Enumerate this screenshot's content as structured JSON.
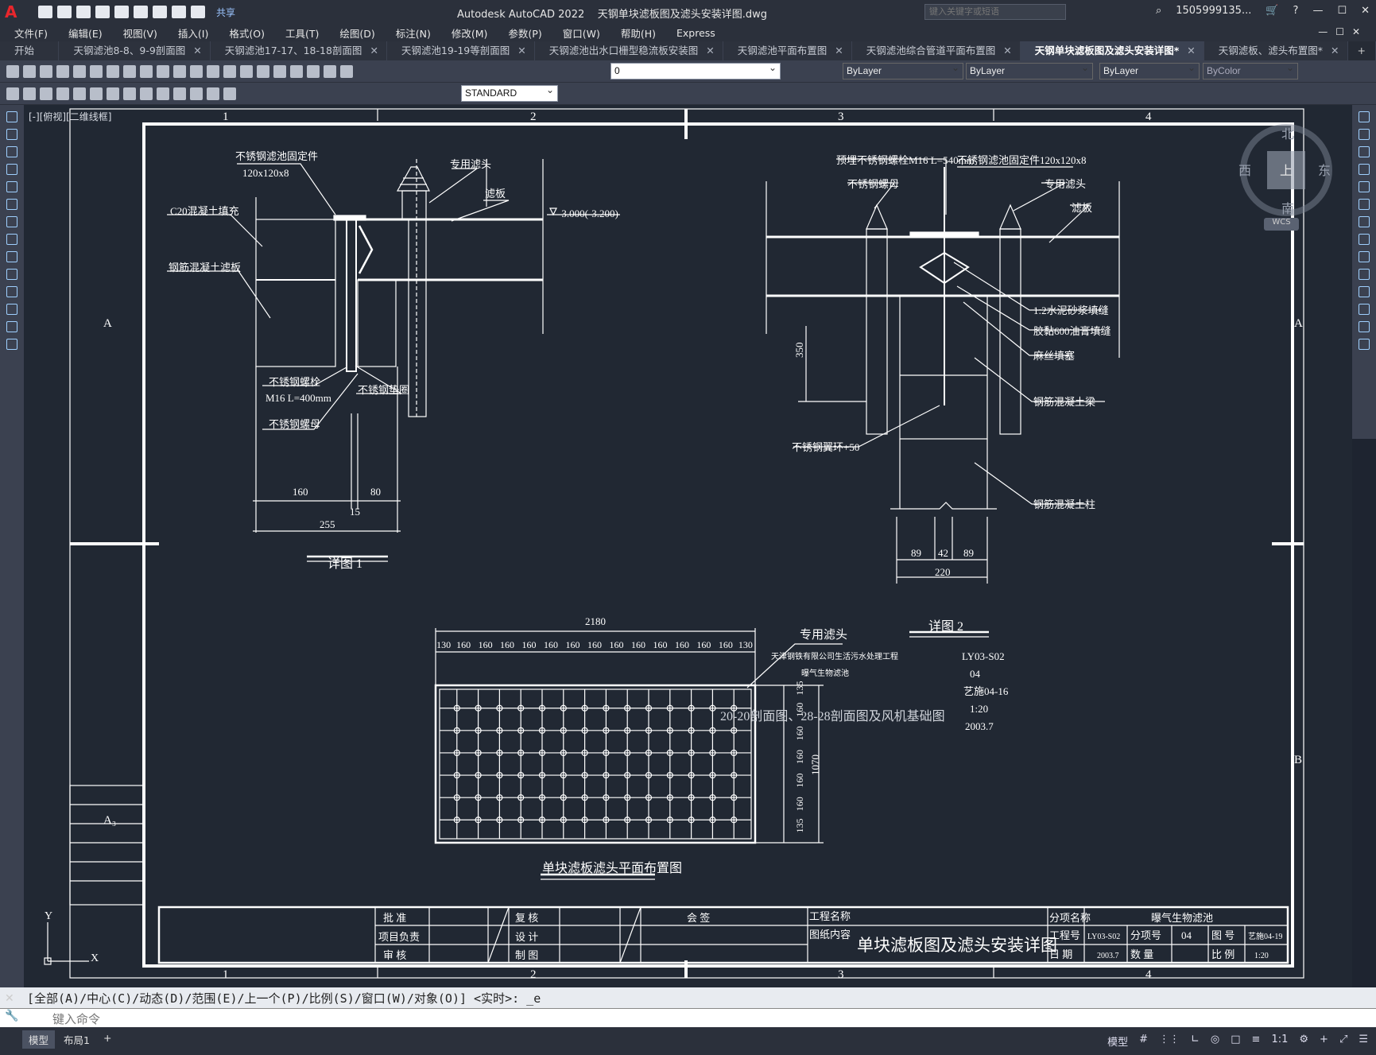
{
  "app": {
    "title": "Autodesk AutoCAD 2022",
    "filename": "天钢单块滤板图及滤头安装详图.dwg",
    "share": "共享",
    "search_placeholder": "键入关键字或短语",
    "user": "1505999135...",
    "menu": [
      "文件(F)",
      "编辑(E)",
      "视图(V)",
      "插入(I)",
      "格式(O)",
      "工具(T)",
      "绘图(D)",
      "标注(N)",
      "修改(M)",
      "参数(P)",
      "窗口(W)",
      "帮助(H)",
      "Express"
    ]
  },
  "tabs": [
    {
      "label": "开始",
      "active": false
    },
    {
      "label": "天钢滤池8-8、9-9剖面图",
      "active": false
    },
    {
      "label": "天钢滤池17-17、18-18剖面图",
      "active": false
    },
    {
      "label": "天钢滤池19-19等剖面图",
      "active": false
    },
    {
      "label": "天钢滤池出水口栅型稳流板安装图",
      "active": false
    },
    {
      "label": "天钢滤池平面布置图",
      "active": false
    },
    {
      "label": "天钢滤池综合管道平面布置图",
      "active": false
    },
    {
      "label": "天钢单块滤板图及滤头安装详图*",
      "active": true
    },
    {
      "label": "天钢滤板、滤头布置图*",
      "active": false
    }
  ],
  "toolbar": {
    "layer": "0",
    "color": "ByLayer",
    "linetype": "ByLayer",
    "lineweight": "ByLayer",
    "plotstyle": "ByColor",
    "textstyle": "STANDARD"
  },
  "viewport_label": "[-][俯视][二维线框]",
  "viewcube": {
    "n": "北",
    "s": "南",
    "e": "东",
    "w": "西",
    "top": "上",
    "wcs": "WCS"
  },
  "drawing": {
    "grid_top": [
      "1",
      "2",
      "3",
      "4"
    ],
    "grid_side": [
      "A",
      "B"
    ],
    "grid_left": [
      "A",
      "A₃"
    ],
    "detail1": {
      "title": "详图 1",
      "labels": [
        "不锈钢滤池固定件",
        "120x120x8",
        "专用滤头",
        "滤板",
        "C20混凝土填充",
        "钢筋混凝土滤板",
        "不锈钢螺栓",
        "M16 L=400mm",
        "不锈钢垫圈",
        "不锈钢螺母",
        "-3.000(-3.200)"
      ],
      "dims": [
        "160",
        "80",
        "15",
        "255"
      ]
    },
    "detail2": {
      "title": "详图 2",
      "labels": [
        "预埋不锈钢螺栓M16 L=540mm",
        "不锈钢滤池固定件120x120x8",
        "不锈钢螺母",
        "专用滤头",
        "滤板",
        "1:2水泥砂浆填缝",
        "胶黏600油膏填缝",
        "麻丝填塞",
        "钢筋混凝土梁",
        "不锈钢翼环+50",
        "钢筋混凝土柱"
      ],
      "dims": [
        "350",
        "89",
        "42",
        "89",
        "220"
      ]
    },
    "plan": {
      "title": "单块滤板滤头平面布置图",
      "total_width": "2180",
      "col_dims": [
        "130",
        "160",
        "160",
        "160",
        "160",
        "160",
        "160",
        "160",
        "160",
        "160",
        "160",
        "160",
        "160",
        "160",
        "130"
      ],
      "row_dims": [
        "135",
        "160",
        "160",
        "160",
        "160",
        "160",
        "135"
      ],
      "total_height": "1070",
      "label": "专用滤头"
    },
    "notes": {
      "company": "天津钢铁有限公司生活污水处理工程",
      "sub": "曝气生物滤池",
      "section_ref": "20-20剖面图、28-28剖面图及风机基础图",
      "codes": [
        "LY03-S02",
        "04",
        "艺施04-16",
        "1:20",
        "2003.7"
      ]
    },
    "titleblock": {
      "approve": "批  准",
      "project_lead": "项目负责",
      "review": "审  核",
      "recheck": "复  核",
      "design": "设  计",
      "draw": "制  图",
      "countersign": "会  签",
      "project_name_label": "工程名称",
      "drawing_content_label": "图纸内容",
      "drawing_title": "单块滤板图及滤头安装详图",
      "sub_item_label": "分项名称",
      "sub_item": "曝气生物滤池",
      "project_no_label": "工程号",
      "project_no": "LY03-S02",
      "sub_no_label": "分项号",
      "sub_no": "04",
      "drawing_no_label": "图  号",
      "drawing_no": "艺施04-19",
      "date_label": "日  期",
      "date": "2003.7",
      "qty_label": "数  量",
      "scale_label": "比  例",
      "scale": "1:20"
    }
  },
  "command": {
    "history": "[全部(A)/中心(C)/动态(D)/范围(E)/上一个(P)/比例(S)/窗口(W)/对象(O)] <实时>: _e",
    "placeholder": "键入命令"
  },
  "status": {
    "layouts": [
      "模型",
      "布局1"
    ],
    "model": "模型",
    "scale": "1:1"
  }
}
